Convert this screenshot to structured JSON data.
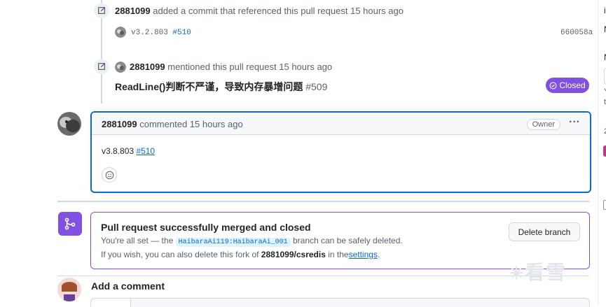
{
  "event1": {
    "user": "2881099",
    "text": "added a commit that referenced this pull request",
    "time": "15 hours ago",
    "commit_message": "v3.2.803",
    "commit_ref": "#510",
    "commit_sha": "660058a"
  },
  "event2": {
    "user": "2881099",
    "text": "mentioned this pull request",
    "time": "15 hours ago",
    "issue_title": "ReadLine()判断不严谨，导致内存暴增问题",
    "issue_number": "#509",
    "status": "Closed"
  },
  "comment": {
    "user": "2881099",
    "action": "commented",
    "time": "15 hours ago",
    "badge": "Owner",
    "body_text": "v3.8.803",
    "body_link": "#510",
    "more_label": "···"
  },
  "merged": {
    "title": "Pull request successfully merged and closed",
    "line1_prefix": "You're all set — the",
    "branch": "HaibaraAi119:HaibaraAi_001",
    "line1_suffix": "branch can be safely deleted.",
    "line2_prefix": "If you wish, you can also delete this fork of",
    "fork": "2881099/csredis",
    "line2_mid": "in the",
    "settings_link": "settings",
    "line2_end": ".",
    "delete_button": "Delete branch"
  },
  "add_comment": {
    "heading": "Add a comment"
  },
  "watermark": "看雪",
  "right_edge": [
    "i",
    "N",
    "N",
    "Y",
    "t",
    "2"
  ],
  "colors": {
    "accent_blue": "#0969da",
    "merged_purple": "#8250df",
    "border": "#d0d7de"
  }
}
